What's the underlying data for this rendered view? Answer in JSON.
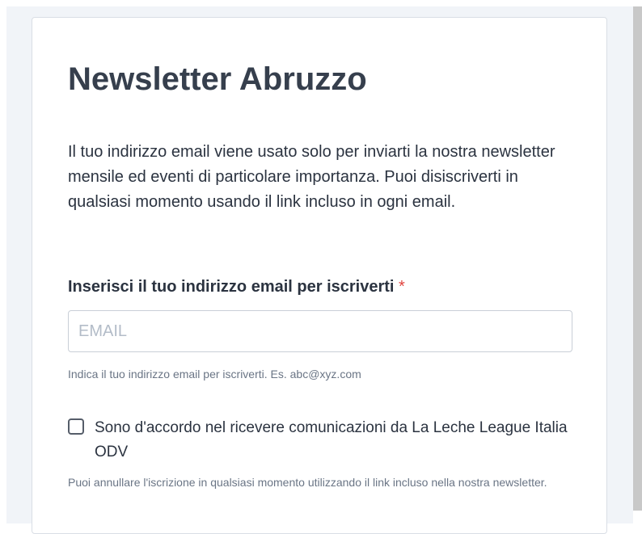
{
  "form": {
    "title": "Newsletter Abruzzo",
    "description": "Il tuo indirizzo email viene usato solo per inviarti la nostra newsletter mensile ed eventi di particolare importanza. Puoi disiscriverti in qualsiasi momento usando il link incluso in ogni email.",
    "email_label": "Inserisci il tuo indirizzo email per iscriverti",
    "required_marker": "*",
    "email_placeholder": "EMAIL",
    "email_value": "",
    "email_hint": "Indica il tuo indirizzo email per iscriverti. Es. abc@xyz.com",
    "consent_label": "Sono d'accordo nel ricevere comunicazioni da La Leche League Italia ODV",
    "consent_checked": false,
    "consent_hint": "Puoi annullare l'iscrizione in qualsiasi momento utilizzando il link incluso nella nostra newsletter."
  },
  "colors": {
    "title": "#363f4d",
    "text": "#2b3340",
    "hint": "#6a7585",
    "required": "#e0443e",
    "border": "#c9cfd7",
    "background": "#f1f4f8"
  }
}
